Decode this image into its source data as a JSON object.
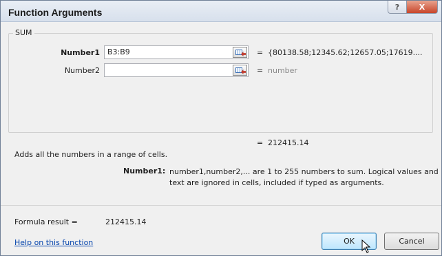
{
  "dialog": {
    "title": "Function Arguments",
    "help_button_label": "?",
    "close_button_label": "X"
  },
  "function": {
    "name": "SUM",
    "arguments": [
      {
        "label": "Number1",
        "value": "B3:B9",
        "equals": "=",
        "result": "{80138.58;12345.62;12657.05;17619...."
      },
      {
        "label": "Number2",
        "value": "",
        "equals": "=",
        "result": "number"
      }
    ],
    "result_equals": "=",
    "result_value": "212415.14",
    "description": "Adds all the numbers in a range of cells.",
    "argument_help_name": "Number1:",
    "argument_help_text": "number1,number2,... are 1 to 255 numbers to sum. Logical values and text are ignored in cells, included if typed as arguments."
  },
  "footer": {
    "formula_result_label": "Formula result =",
    "formula_result_value": "212415.14",
    "help_link": "Help on this function",
    "ok_label": "OK",
    "cancel_label": "Cancel"
  }
}
